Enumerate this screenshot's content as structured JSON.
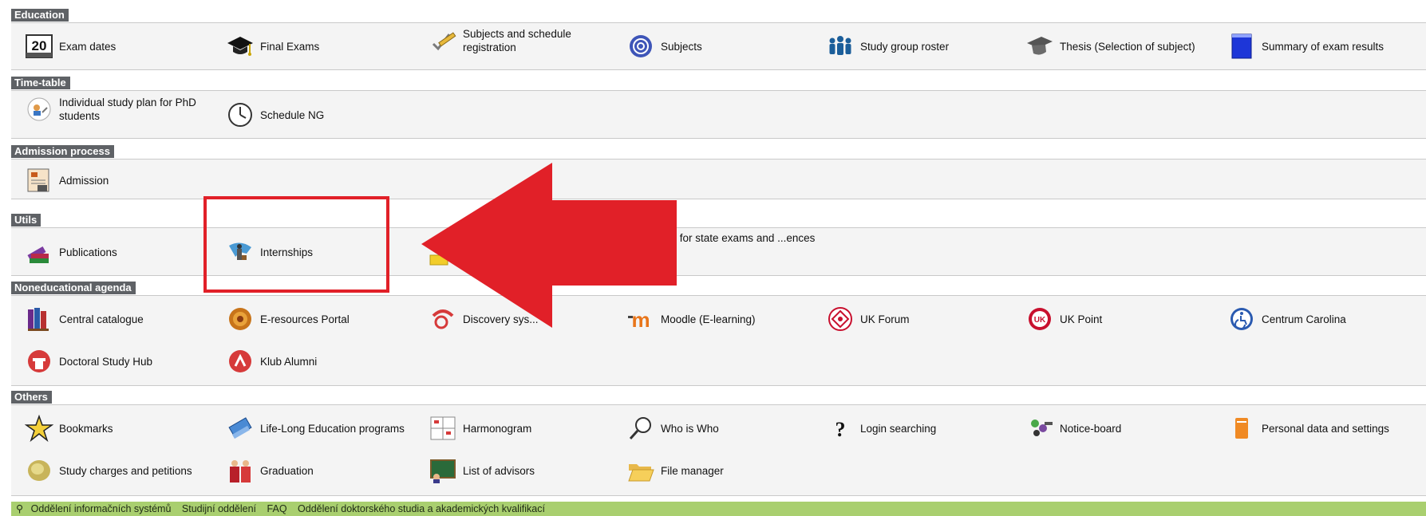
{
  "sections": [
    {
      "title": "Education",
      "items": [
        {
          "label": "Exam dates",
          "icon": "calendar-20-icon"
        },
        {
          "label": "Final Exams",
          "icon": "graduation-cap-icon"
        },
        {
          "label": "Subjects and schedule registration",
          "icon": "pencil-check-icon"
        },
        {
          "label": "Subjects",
          "icon": "knot-icon"
        },
        {
          "label": "Study group roster",
          "icon": "people-icon"
        },
        {
          "label": "Thesis (Selection of subject)",
          "icon": "academic-cap-icon"
        },
        {
          "label": "Summary of exam results",
          "icon": "blue-book-icon"
        }
      ]
    },
    {
      "title": "Time-table",
      "items": [
        {
          "label": "Individual study plan for PhD students",
          "icon": "study-plan-icon"
        },
        {
          "label": "Schedule NG",
          "icon": "clock-icon"
        }
      ]
    },
    {
      "title": "Admission process",
      "items": [
        {
          "label": "Admission",
          "icon": "application-form-icon"
        }
      ]
    },
    {
      "title": "Utils",
      "items": [
        {
          "label": "Publications",
          "icon": "books-icon"
        },
        {
          "label": "Internships",
          "icon": "globe-traveler-icon"
        },
        {
          "label": "",
          "icon": "yellow-folder-icon"
        },
        {
          "label": "...ltations for state exams and ...ences",
          "icon": "none"
        }
      ]
    },
    {
      "title": "Noneducational agenda",
      "items": [
        {
          "label": "Central catalogue",
          "icon": "catalogue-books-icon"
        },
        {
          "label": "E-resources Portal",
          "icon": "seal-icon"
        },
        {
          "label": "Discovery sys...",
          "icon": "discovery-icon"
        },
        {
          "label": "Moodle (E-learning)",
          "icon": "moodle-icon"
        },
        {
          "label": "UK Forum",
          "icon": "uk-forum-icon"
        },
        {
          "label": "UK Point",
          "icon": "uk-point-icon"
        },
        {
          "label": "Centrum Carolina",
          "icon": "accessibility-icon"
        },
        {
          "label": "Doctoral Study Hub",
          "icon": "hub-icon"
        },
        {
          "label": "Klub Alumni",
          "icon": "alumni-icon"
        }
      ]
    },
    {
      "title": "Others",
      "items": [
        {
          "label": "Bookmarks",
          "icon": "star-bookmark-icon"
        },
        {
          "label": "Life-Long Education programs",
          "icon": "blue-book-stack-icon"
        },
        {
          "label": "Harmonogram",
          "icon": "harmonogram-icon"
        },
        {
          "label": "Who is Who",
          "icon": "magnifier-icon"
        },
        {
          "label": "Login searching",
          "icon": "question-mark-icon"
        },
        {
          "label": "Notice-board",
          "icon": "notice-board-icon"
        },
        {
          "label": "Personal data and settings",
          "icon": "orange-card-icon"
        },
        {
          "label": "Study charges and petitions",
          "icon": "charges-icon"
        },
        {
          "label": "Graduation",
          "icon": "graduation-people-icon"
        },
        {
          "label": "List of advisors",
          "icon": "chalkboard-icon"
        },
        {
          "label": "File manager",
          "icon": "open-folder-icon"
        }
      ]
    }
  ],
  "footer": {
    "links": [
      "Oddělení informačních systémů",
      "Studijní oddělení",
      "FAQ",
      "Oddělení doktorského studia a akademických kvalifikací"
    ]
  },
  "colors": {
    "section_header": "#5f6266",
    "section_body": "#f4f4f4",
    "footer": "#a9cf6f",
    "annotation": "#e12028"
  }
}
